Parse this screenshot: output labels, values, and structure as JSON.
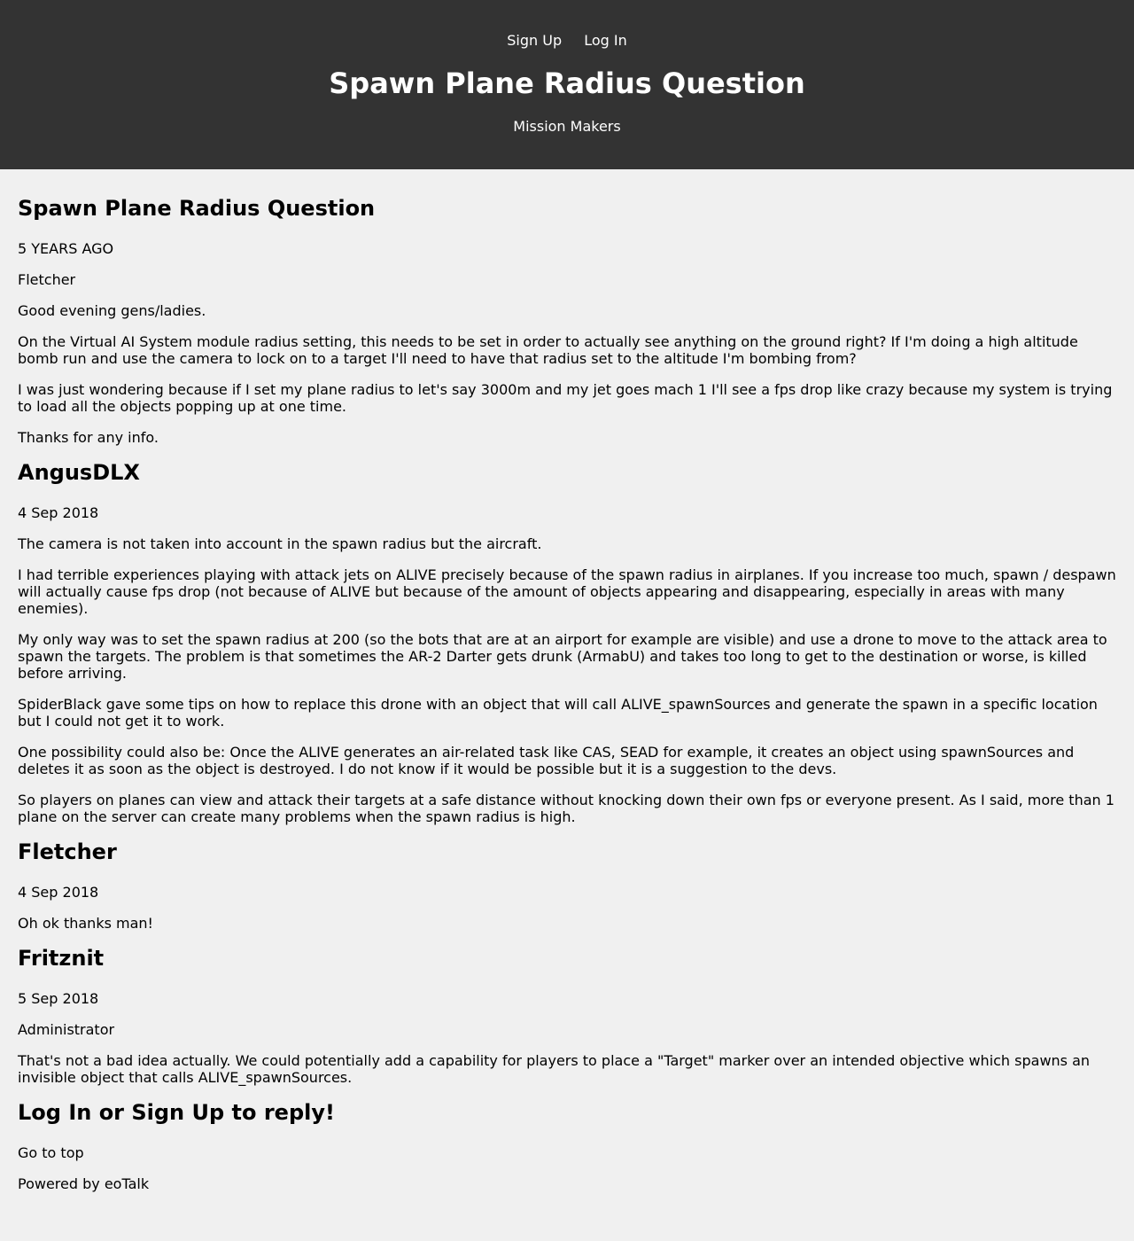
{
  "header": {
    "nav": {
      "signup_label": "Sign Up",
      "login_label": "Log In"
    },
    "title": "Spawn Plane Radius Question",
    "channel": "Mission Makers"
  },
  "thread": {
    "title": "Spawn Plane Radius Question",
    "time": "5 YEARS AGO",
    "author": "Fletcher",
    "paragraphs": [
      "Good evening gens/ladies.",
      "On the Virtual AI System module radius setting, this needs to be set in order to actually see anything on the ground right? If I'm doing a high altitude bomb run and use the camera to lock on to a target I'll need to have that radius set to the altitude I'm bombing from?",
      "I was just wondering because if I set my plane radius to let's say 3000m and my jet goes mach 1 I'll see a fps drop like crazy because my system is trying to load all the objects popping up at one time.",
      "Thanks for any info."
    ]
  },
  "posts": [
    {
      "author": "AngusDLX",
      "date": "4 Sep 2018",
      "paragraphs": [
        "The camera is not taken into account in the spawn radius but the aircraft.",
        "I had terrible experiences playing with attack jets on ALIVE precisely because of the spawn radius in airplanes. If you increase too much, spawn / despawn will actually cause fps drop (not because of ALIVE but because of the amount of objects appearing and disappearing, especially in areas with many enemies).",
        "My only way was to set the spawn radius at 200 (so the bots that are at an airport for example are visible) and use a drone to move to the attack area to spawn the targets. The problem is that sometimes the AR-2 Darter gets drunk (ArmabU) and takes too long to get to the destination or worse, is killed before arriving.",
        "SpiderBlack gave some tips on how to replace this drone with an object that will call ALIVE_spawnSources and generate the spawn in a specific location but I could not get it to work.",
        "One possibility could also be: Once the ALIVE generates an air-related task like CAS, SEAD for example, it creates an object using spawnSources and deletes it as soon as the object is destroyed. I do not know if it would be possible but it is a suggestion to the devs.",
        "So players on planes can view and attack their targets at a safe distance without knocking down their own fps or everyone present. As I said, more than 1 plane on the server can create many problems when the spawn radius is high."
      ]
    },
    {
      "author": "Fletcher",
      "date": "4 Sep 2018",
      "paragraphs": [
        "Oh ok thanks man!"
      ]
    },
    {
      "author": "Fritznit",
      "date": "5 Sep 2018",
      "role": "Administrator",
      "paragraphs": [
        "That's not a bad idea actually. We could potentially add a capability for players to place a \"Target\" marker over an intended objective which spawns an invisible object that calls ALIVE_spawnSources."
      ]
    }
  ],
  "reply_prompt": "Log In or Sign Up to reply!",
  "footer": {
    "go_to_top": "Go to top",
    "powered_by": "Powered by eoTalk"
  }
}
